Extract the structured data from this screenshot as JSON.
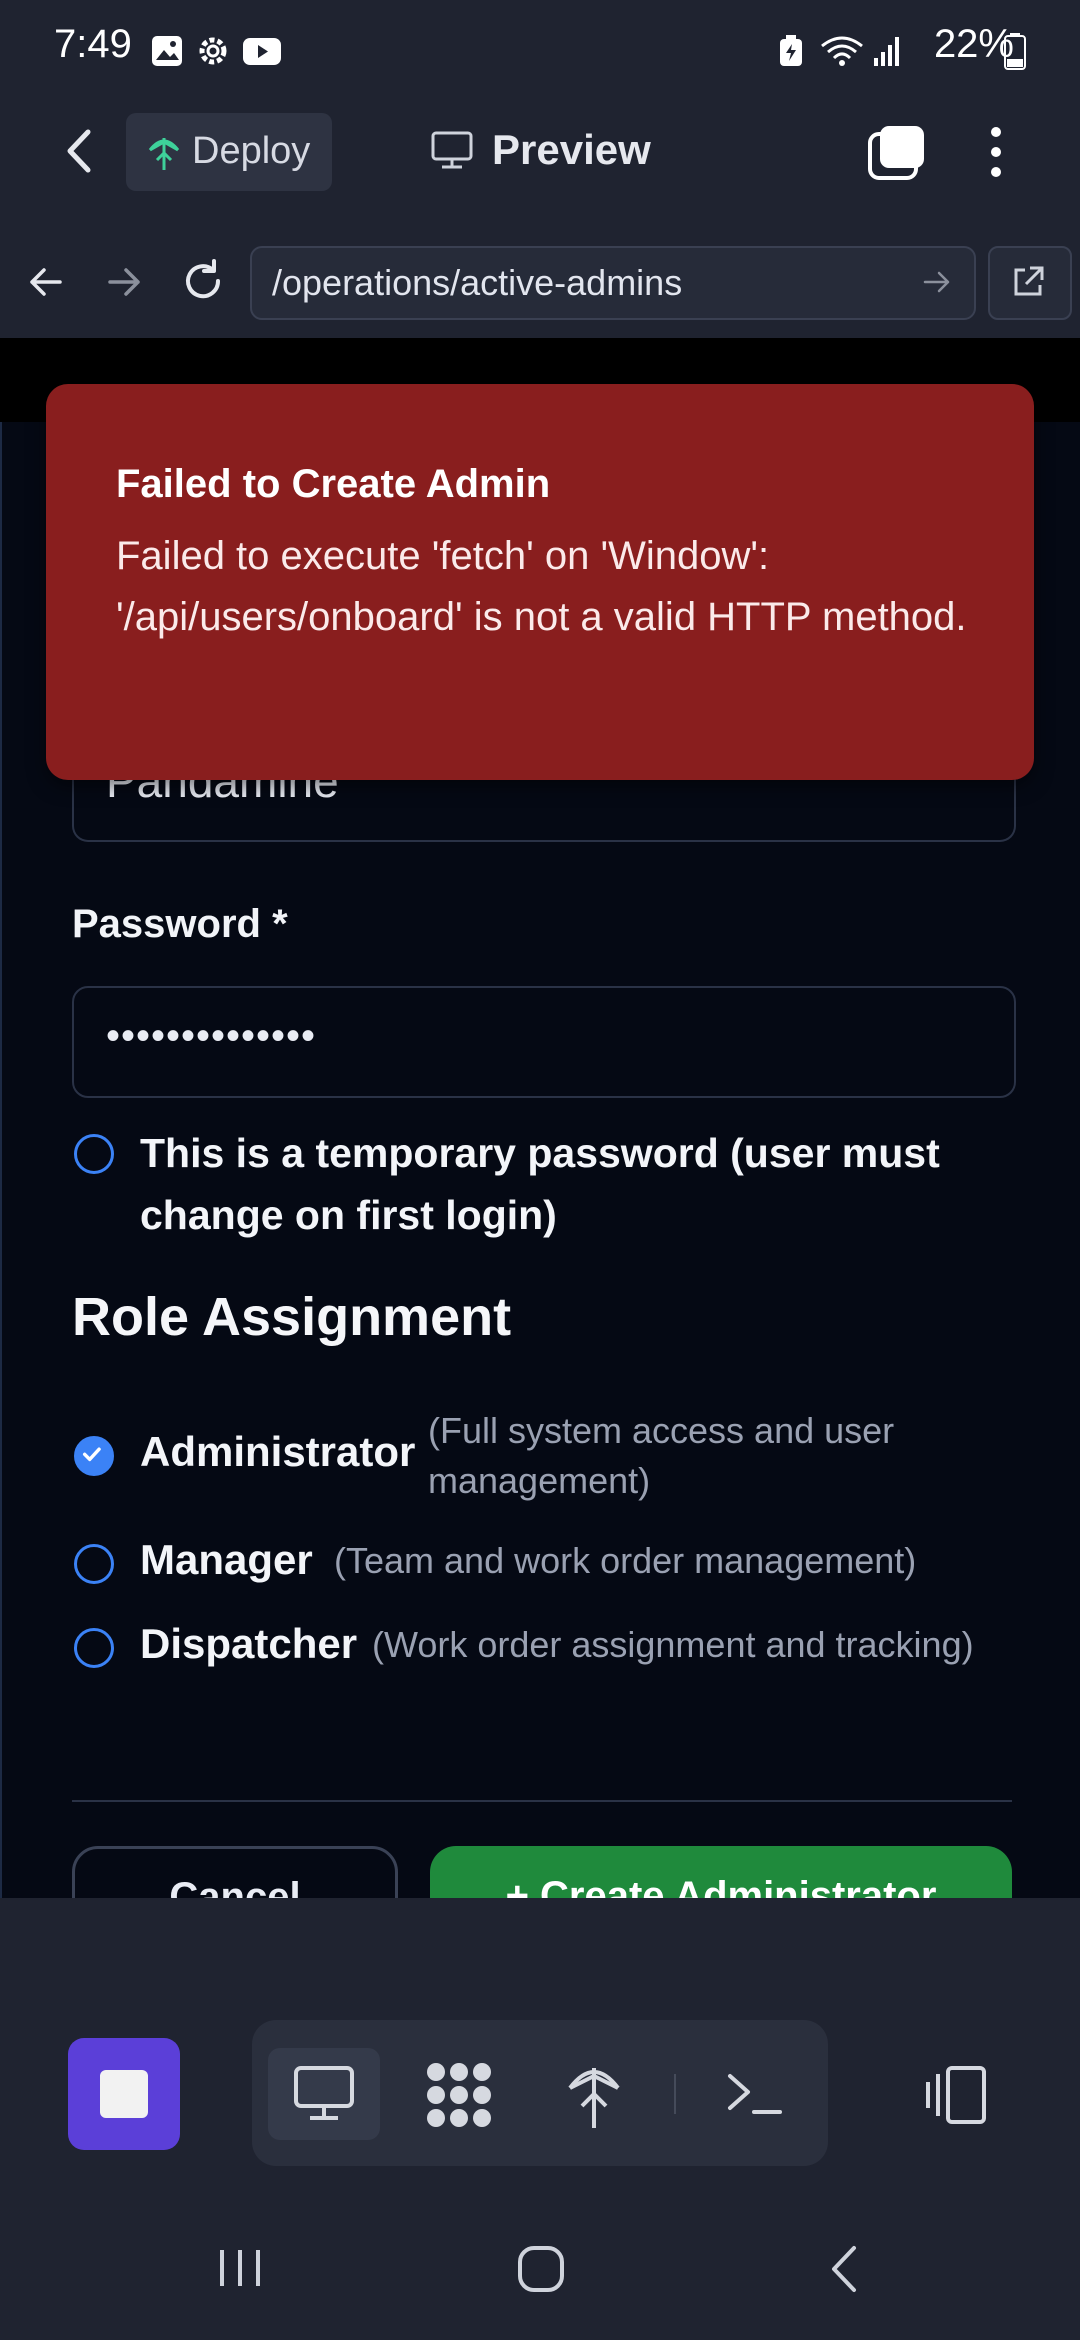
{
  "status_bar": {
    "time": "7:49",
    "battery": "22%",
    "icons": [
      "gallery-icon",
      "settings-icon",
      "youtube-icon",
      "battery-saver-icon",
      "wifi-icon",
      "signal-icon",
      "battery-icon"
    ]
  },
  "header": {
    "back_icon": "back-arrow-icon",
    "deploy_label": "Deploy",
    "preview_label": "Preview",
    "tabs_icon": "tabs-icon",
    "menu_icon": "more-vert-icon"
  },
  "url_bar": {
    "url": "/operations/active-admins",
    "icons": [
      "nav-back-icon",
      "nav-forward-icon",
      "reload-icon",
      "go-arrow-icon",
      "open-external-icon"
    ]
  },
  "form": {
    "username_value": "Pandamine",
    "password_label": "Password *",
    "password_value": "••••••••••••••",
    "temp_password_label": "This is a temporary password (user must change on first login)",
    "role_heading": "Role Assignment",
    "roles": [
      {
        "label": "Administrator",
        "description": "(Full system access and user management)",
        "checked": true
      },
      {
        "label": "Manager",
        "description": "(Team and work order management)",
        "checked": false
      },
      {
        "label": "Dispatcher",
        "description": "(Work order assignment and tracking)",
        "checked": false
      }
    ],
    "cancel_label": "Cancel",
    "create_label": "+ Create Administrator"
  },
  "toast": {
    "title": "Failed to Create Admin",
    "message": "Failed to execute 'fetch' on 'Window': '/api/users/onboard' is not a valid HTTP method."
  },
  "toolbar": {
    "icons": [
      "stop-icon",
      "preview-monitor-icon",
      "apps-grid-icon",
      "deploy-icon",
      "terminal-icon",
      "layout-icon"
    ]
  },
  "colors": {
    "toast_bg": "#891e1e",
    "accent_blue": "#3b82f6",
    "create_button": "#1f8a3c",
    "stop_button": "#5b3fd8"
  }
}
